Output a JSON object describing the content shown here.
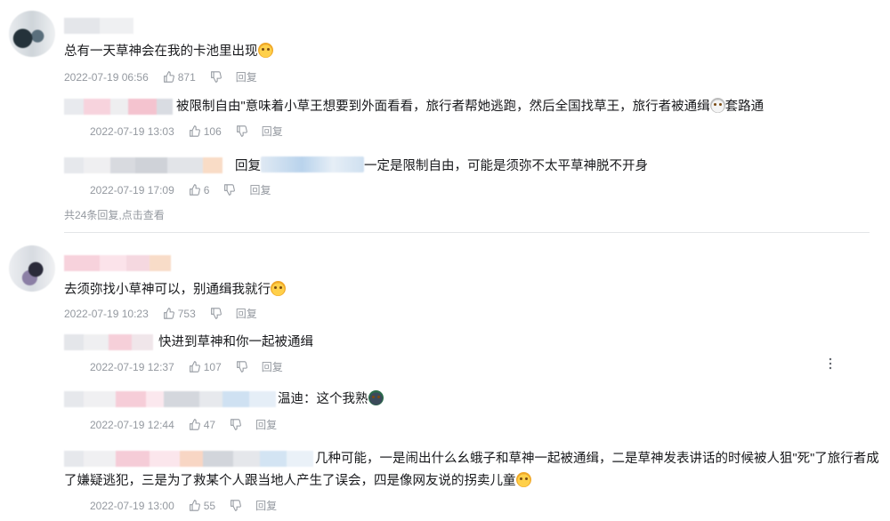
{
  "threads": [
    {
      "comment": {
        "text": "总有一天草神会在我的卡池里出现",
        "time": "2022-07-19 06:56",
        "likes": "871",
        "reply_label": "回复"
      },
      "replies": [
        {
          "text": "被限制自由\"意味着小草王想要到外面看看，旅行者帮她逃跑，然后全国找草王，旅行者被通缉",
          "text_tail": "套路通",
          "time": "2022-07-19 13:03",
          "likes": "106",
          "reply_label": "回复"
        },
        {
          "prefix": "回复",
          "text": "一定是限制自由，可能是须弥不太平草神脱不开身",
          "time": "2022-07-19 17:09",
          "likes": "6",
          "reply_label": "回复"
        }
      ],
      "more_replies": {
        "count_text": "共24条回复,",
        "link_text": "点击查看"
      }
    },
    {
      "comment": {
        "text": "去须弥找小草神可以，别通缉我就行",
        "time": "2022-07-19 10:23",
        "likes": "753",
        "reply_label": "回复"
      },
      "replies": [
        {
          "text": "快进到草神和你一起被通缉",
          "time": "2022-07-19 12:37",
          "likes": "107",
          "reply_label": "回复"
        },
        {
          "text": "温迪：这个我熟",
          "time": "2022-07-19 12:44",
          "likes": "47",
          "reply_label": "回复"
        },
        {
          "text_line1": "几种可能，一是闹出什么幺蛾子和草神一起被通缉，二是草神发表讲话的时候被人狙\"死\"了旅行者成",
          "text_line2": "了嫌疑逃犯，三是为了救某个人跟当地人产生了误会，四是像网友说的拐卖儿童",
          "time": "2022-07-19 13:00",
          "likes": "55",
          "reply_label": "回复"
        }
      ]
    }
  ],
  "icons": {
    "like": "thumbs-up-icon",
    "dislike": "thumbs-down-icon",
    "emoji": "cat-emoji-icon",
    "more": "vertical-dots-icon"
  },
  "colors": {
    "text": "#18191c",
    "meta": "#9499a0",
    "divider": "#e3e5e7"
  }
}
